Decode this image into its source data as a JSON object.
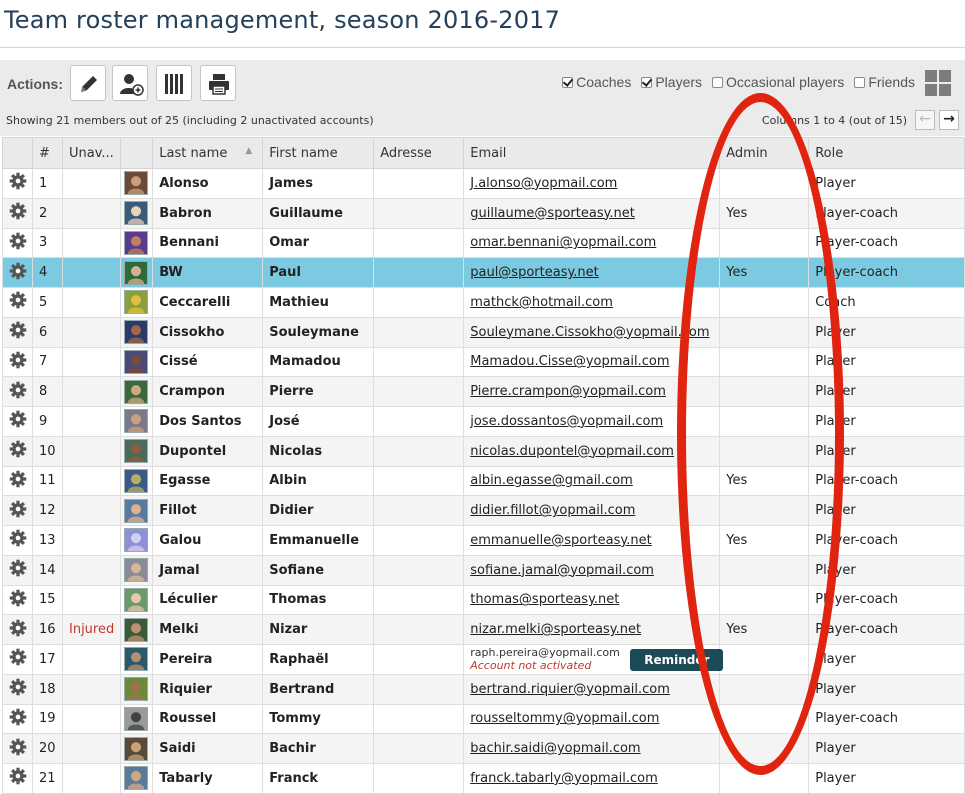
{
  "page": {
    "title": "Team roster management, season 2016-2017"
  },
  "toolbar": {
    "actions_label": "Actions:",
    "buttons": [
      {
        "icon": "pencil-icon"
      },
      {
        "icon": "add-user-icon"
      },
      {
        "icon": "barcode-icon"
      },
      {
        "icon": "printer-icon"
      }
    ],
    "filters": [
      {
        "label": "Coaches",
        "checked": true
      },
      {
        "label": "Players",
        "checked": true
      },
      {
        "label": "Occasional players",
        "checked": false
      },
      {
        "label": "Friends",
        "checked": false
      }
    ],
    "view_icon": "grid-view-icon"
  },
  "status": {
    "summary": "Showing 21 members out of 25 (including 2 unactivated accounts)",
    "columns_info": "Columns 1 to 4 (out of 15)"
  },
  "table": {
    "headers": [
      "",
      "#",
      "Unav...",
      "",
      "Last name",
      "First name",
      "Adresse",
      "Email",
      "Admin",
      "Role"
    ],
    "reminder_label": "Reminder",
    "rows": [
      {
        "num": "1",
        "unav": "",
        "last": "Alonso",
        "first": "James",
        "email": "J.alonso@yopmail.com",
        "admin": "",
        "role": "Player"
      },
      {
        "num": "2",
        "unav": "",
        "last": "Babron",
        "first": "Guillaume",
        "email": "guillaume@sporteasy.net",
        "admin": "Yes",
        "role": "Player-coach"
      },
      {
        "num": "3",
        "unav": "",
        "last": "Bennani",
        "first": "Omar",
        "email": "omar.bennani@yopmail.com",
        "admin": "",
        "role": "Player-coach"
      },
      {
        "num": "4",
        "unav": "",
        "last": "BW",
        "first": "Paul",
        "email": "paul@sporteasy.net",
        "admin": "Yes",
        "role": "Player-coach",
        "selected": true
      },
      {
        "num": "5",
        "unav": "",
        "last": "Ceccarelli",
        "first": "Mathieu",
        "email": "mathck@hotmail.com",
        "admin": "",
        "role": "Coach"
      },
      {
        "num": "6",
        "unav": "",
        "last": "Cissokho",
        "first": "Souleymane",
        "email": "Souleymane.Cissokho@yopmail.com",
        "admin": "",
        "role": "Player"
      },
      {
        "num": "7",
        "unav": "",
        "last": "Cissé",
        "first": "Mamadou",
        "email": "Mamadou.Cisse@yopmail.com",
        "admin": "",
        "role": "Player"
      },
      {
        "num": "8",
        "unav": "",
        "last": "Crampon",
        "first": "Pierre",
        "email": "Pierre.crampon@yopmail.com",
        "admin": "",
        "role": "Player"
      },
      {
        "num": "9",
        "unav": "",
        "last": "Dos Santos",
        "first": "José",
        "email": "jose.dossantos@yopmail.com",
        "admin": "",
        "role": "Player"
      },
      {
        "num": "10",
        "unav": "",
        "last": "Dupontel",
        "first": "Nicolas",
        "email": "nicolas.dupontel@yopmail.com",
        "admin": "",
        "role": "Player"
      },
      {
        "num": "11",
        "unav": "",
        "last": "Egasse",
        "first": "Albin",
        "email": "albin.egasse@gmail.com",
        "admin": "Yes",
        "role": "Player-coach"
      },
      {
        "num": "12",
        "unav": "",
        "last": "Fillot",
        "first": "Didier",
        "email": "didier.fillot@yopmail.com",
        "admin": "",
        "role": "Player"
      },
      {
        "num": "13",
        "unav": "",
        "last": "Galou",
        "first": "Emmanuelle",
        "email": "emmanuelle@sporteasy.net",
        "admin": "Yes",
        "role": "Player-coach"
      },
      {
        "num": "14",
        "unav": "",
        "last": "Jamal",
        "first": "Sofiane",
        "email": "sofiane.jamal@yopmail.com",
        "admin": "",
        "role": "Player"
      },
      {
        "num": "15",
        "unav": "",
        "last": "Léculier",
        "first": "Thomas",
        "email": "thomas@sporteasy.net",
        "admin": "",
        "role": "Player-coach"
      },
      {
        "num": "16",
        "unav": "Injured",
        "last": "Melki",
        "first": "Nizar",
        "email": "nizar.melki@sporteasy.net",
        "admin": "Yes",
        "role": "Player-coach"
      },
      {
        "num": "17",
        "unav": "",
        "last": "Pereira",
        "first": "Raphaël",
        "email": "raph.pereira@yopmail.com",
        "email_note": "Account not activated",
        "pending": true,
        "admin": "",
        "role": "Player"
      },
      {
        "num": "18",
        "unav": "",
        "last": "Riquier",
        "first": "Bertrand",
        "email": "bertrand.riquier@yopmail.com",
        "admin": "",
        "role": "Player"
      },
      {
        "num": "19",
        "unav": "",
        "last": "Roussel",
        "first": "Tommy",
        "email": "rousseltommy@yopmail.com",
        "admin": "",
        "role": "Player-coach"
      },
      {
        "num": "20",
        "unav": "",
        "last": "Saidi",
        "first": "Bachir",
        "email": "bachir.saidi@yopmail.com",
        "admin": "",
        "role": "Player"
      },
      {
        "num": "21",
        "unav": "",
        "last": "Tabarly",
        "first": "Franck",
        "email": "franck.tabarly@yopmail.com",
        "admin": "",
        "role": "Player"
      }
    ]
  },
  "colors": {
    "selected_row": "#7ccae2",
    "annotation_oval": "#e0240f",
    "title": "#25405a",
    "reminder_button": "#1c4a57"
  }
}
